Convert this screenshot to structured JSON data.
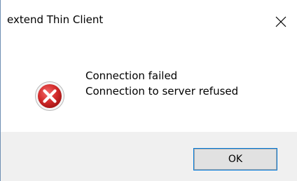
{
  "window": {
    "title": "extend Thin Client"
  },
  "message": {
    "line1": "Connection failed",
    "line2": "Connection to server refused"
  },
  "buttons": {
    "ok_label": "OK"
  },
  "icons": {
    "status": "error-icon",
    "close": "close-icon"
  },
  "colors": {
    "error_red": "#d32b2b",
    "footer_bg": "#f0f0f0",
    "focus_blue": "#0078d7"
  }
}
